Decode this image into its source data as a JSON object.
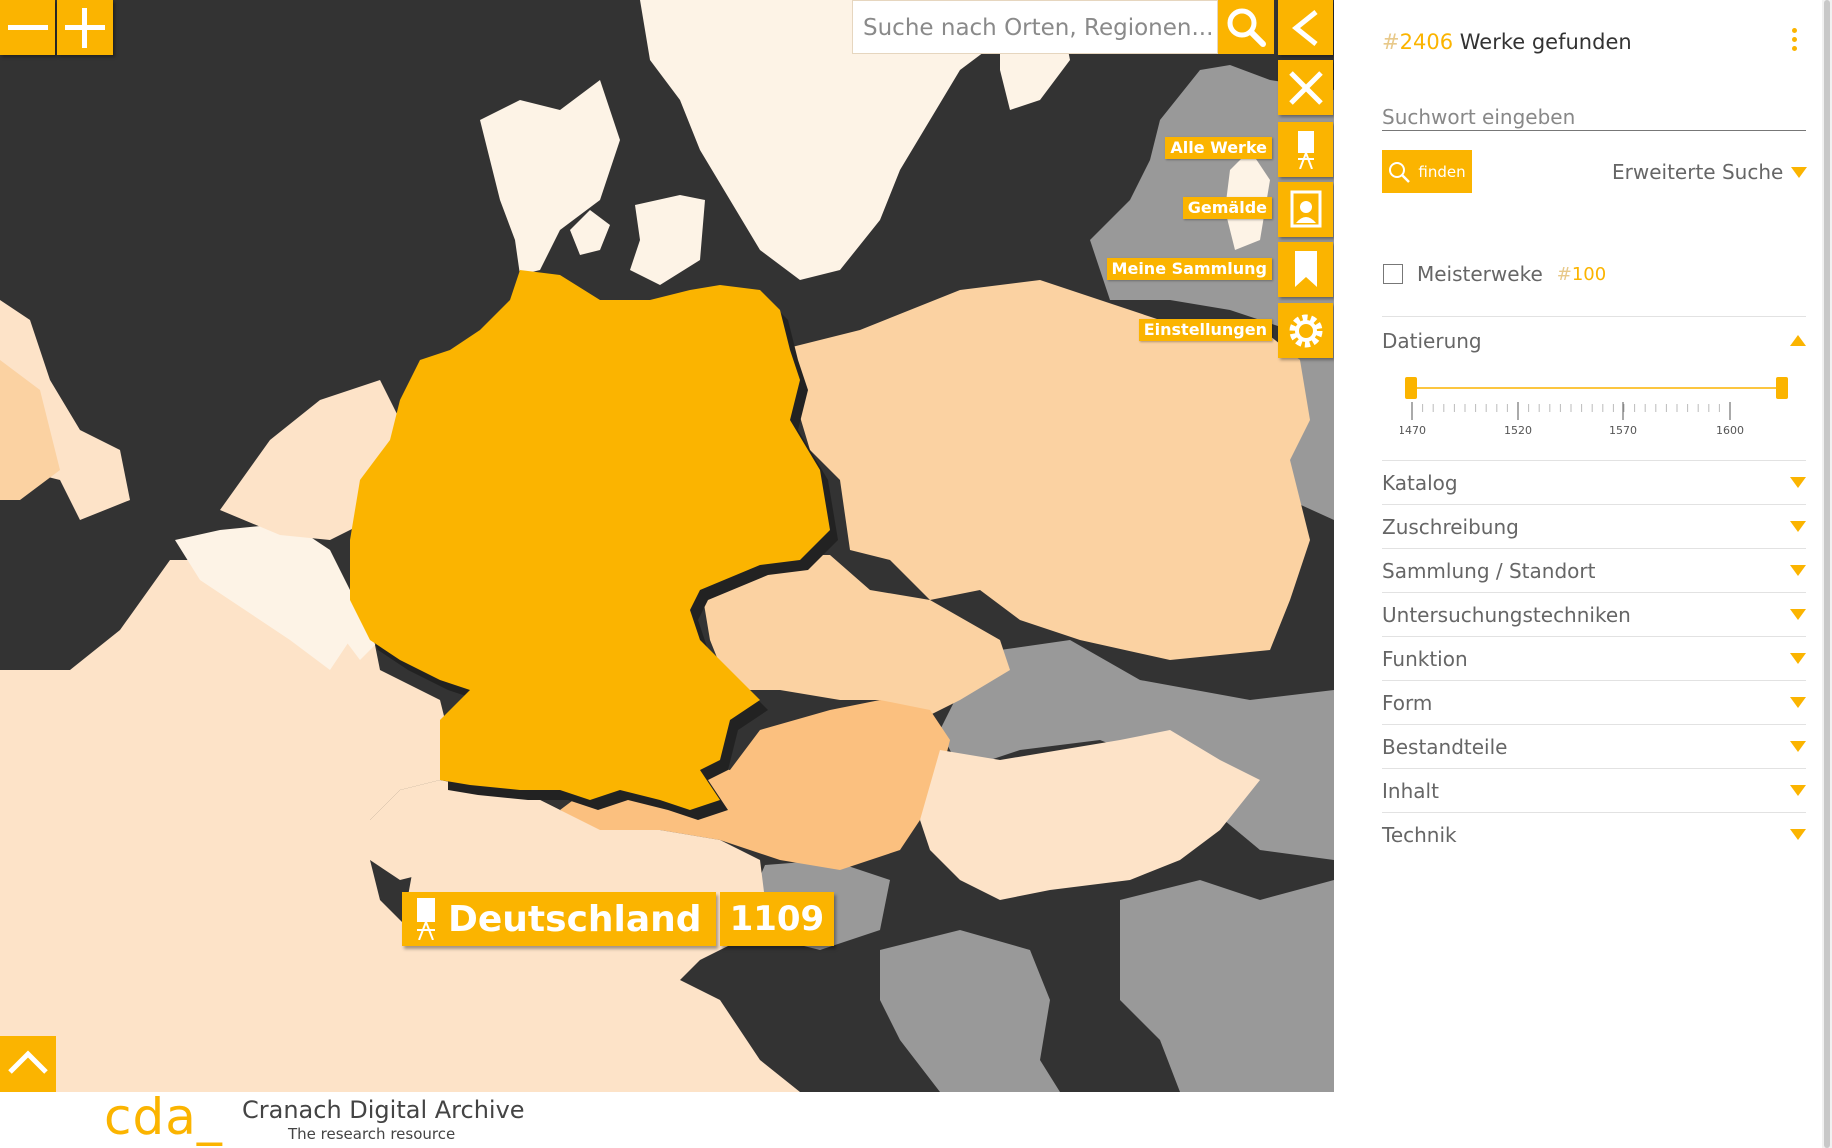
{
  "map": {
    "search_placeholder": "Suche nach Orten, Regionen...",
    "menu": [
      {
        "label": "Alle Werke",
        "icon": "easel-icon"
      },
      {
        "label": "Gemälde",
        "icon": "painting-icon"
      },
      {
        "label": "Meine Sammlung",
        "icon": "bookmark-icon"
      },
      {
        "label": "Einstellungen",
        "icon": "gear-icon"
      }
    ],
    "highlight": {
      "country": "Deutschland",
      "count": "1109"
    },
    "colors": {
      "accent": "#fbb400",
      "sea": "#333333",
      "no_data": "#999999",
      "level_1": "#fdf3e6",
      "level_2": "#fde3c8",
      "level_3": "#fbd2a2",
      "level_4": "#fbc07f"
    }
  },
  "footer": {
    "logo": "cda_",
    "title": "Cranach Digital Archive",
    "subtitle": "The research resource"
  },
  "panel": {
    "results": {
      "hash": "#",
      "count": "2406",
      "label": "Werke gefunden"
    },
    "keyword_placeholder": "Suchwort eingeben",
    "find_label": "finden",
    "advanced_label": "Erweiterte Suche",
    "masterworks": {
      "label": "Meisterweke",
      "hash": "#",
      "count": "100",
      "checked": false
    },
    "dating": {
      "label": "Datierung",
      "range": [
        1470,
        1620
      ],
      "ticks": [
        "1470",
        "1520",
        "1570",
        "1600"
      ]
    },
    "filters": [
      "Katalog",
      "Zuschreibung",
      "Sammlung / Standort",
      "Untersuchungstechniken",
      "Funktion",
      "Form",
      "Bestandteile",
      "Inhalt",
      "Technik"
    ]
  }
}
